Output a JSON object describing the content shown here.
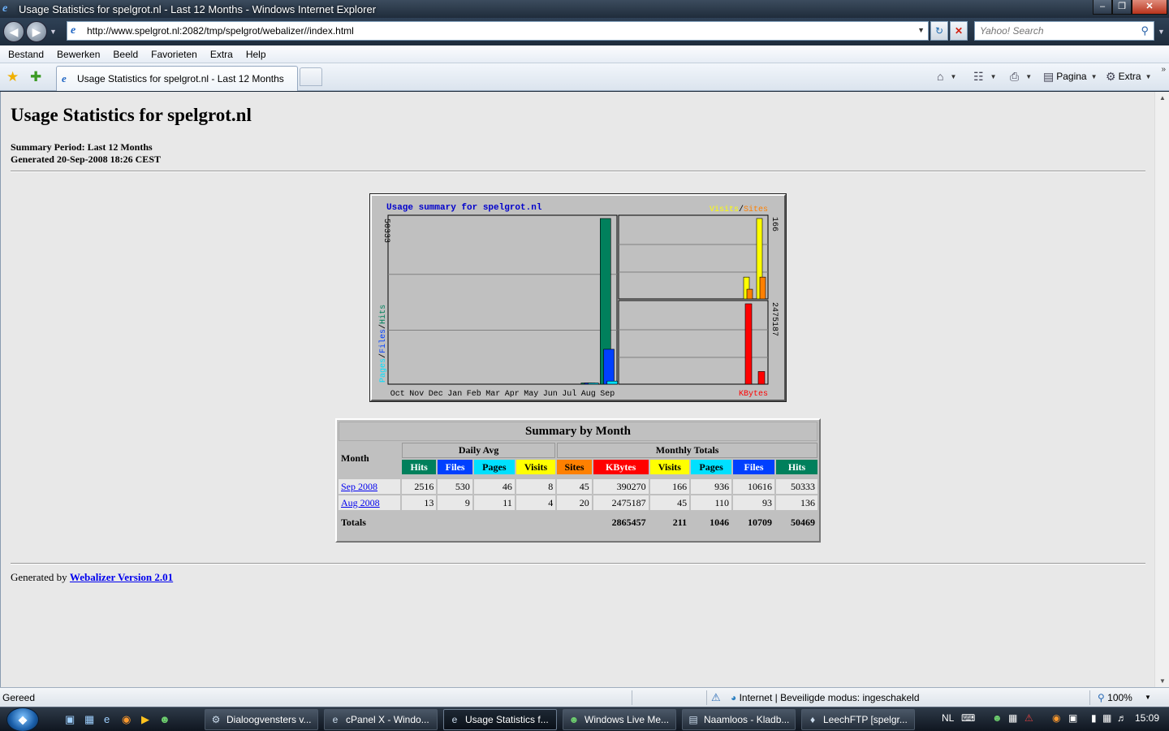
{
  "window": {
    "title": "Usage Statistics for spelgrot.nl - Last 12 Months - Windows Internet Explorer"
  },
  "address": {
    "url": "http://www.spelgrot.nl:2082/tmp/spelgrot/webalizer//index.html",
    "search_placeholder": "Yahoo! Search"
  },
  "menu": [
    "Bestand",
    "Bewerken",
    "Beeld",
    "Favorieten",
    "Extra",
    "Help"
  ],
  "tab": {
    "label": "Usage Statistics for spelgrot.nl - Last 12 Months"
  },
  "commandbar": {
    "page_label": "Pagina",
    "tools_label": "Extra"
  },
  "page": {
    "heading": "Usage Statistics for spelgrot.nl",
    "period": "Summary Period: Last 12 Months",
    "generated": "Generated 20-Sep-2008 18:26 CEST",
    "generated_by_prefix": "Generated by ",
    "generated_by_link": "Webalizer Version 2.01"
  },
  "chart_data": {
    "type": "bar",
    "title": "Usage summary for spelgrot.nl",
    "categories": [
      "Oct",
      "Nov",
      "Dec",
      "Jan",
      "Feb",
      "Mar",
      "Apr",
      "May",
      "Jun",
      "Jul",
      "Aug",
      "Sep"
    ],
    "left_axis_label": [
      "Pages",
      "/",
      "Files",
      "/",
      "Hits"
    ],
    "left_axis_max": "50333",
    "top_right_legend": [
      "Visits",
      "/",
      "Sites"
    ],
    "top_right_axis_max": "166",
    "bottom_right_axis_max": "2475187",
    "bottom_right_label": "KBytes",
    "series_main": [
      {
        "name": "Hits",
        "color": "#00805c",
        "values": [
          0,
          0,
          0,
          0,
          0,
          0,
          0,
          0,
          0,
          0,
          136,
          50333
        ]
      },
      {
        "name": "Files",
        "color": "#0040ff",
        "values": [
          0,
          0,
          0,
          0,
          0,
          0,
          0,
          0,
          0,
          0,
          93,
          10616
        ]
      },
      {
        "name": "Pages",
        "color": "#00e0ff",
        "values": [
          0,
          0,
          0,
          0,
          0,
          0,
          0,
          0,
          0,
          0,
          110,
          936
        ]
      }
    ],
    "series_visits": [
      {
        "name": "Visits",
        "color": "#ffff00",
        "values": [
          45,
          166
        ]
      },
      {
        "name": "Sites",
        "color": "#ff8000",
        "values": [
          20,
          45
        ]
      }
    ],
    "series_kbytes": [
      {
        "name": "KBytes",
        "color": "#ff0000",
        "values": [
          2475187,
          390270
        ]
      }
    ],
    "colors": {
      "title": "#0000cc",
      "visits": "#ffff00",
      "sites": "#ff8000",
      "kbytes": "#ff0000",
      "hits": "#00805c",
      "files": "#0040ff",
      "pages": "#00e0ff"
    }
  },
  "summary": {
    "caption": "Summary by Month",
    "month_header": "Month",
    "daily_avg": "Daily Avg",
    "monthly_totals": "Monthly Totals",
    "daily_cols": [
      "Hits",
      "Files",
      "Pages",
      "Visits"
    ],
    "monthly_cols": [
      "Sites",
      "KBytes",
      "Visits",
      "Pages",
      "Files",
      "Hits"
    ],
    "rows": [
      {
        "month": "Sep 2008",
        "values": [
          "2516",
          "530",
          "46",
          "8",
          "45",
          "390270",
          "166",
          "936",
          "10616",
          "50333"
        ]
      },
      {
        "month": "Aug 2008",
        "values": [
          "13",
          "9",
          "11",
          "4",
          "20",
          "2475187",
          "45",
          "110",
          "93",
          "136"
        ]
      }
    ],
    "totals_label": "Totals",
    "totals": [
      "2865457",
      "211",
      "1046",
      "10709",
      "50469"
    ]
  },
  "status": {
    "text": "Gereed",
    "zone": "Internet | Beveiligde modus: ingeschakeld",
    "zoom": "100%"
  },
  "taskbar": {
    "buttons": [
      "Dialoogvensters v...",
      "cPanel X - Windo...",
      "Usage Statistics f...",
      "Windows Live Me...",
      "Naamloos - Kladb...",
      "LeechFTP [spelgr..."
    ],
    "language": "NL",
    "clock": "15:09"
  }
}
